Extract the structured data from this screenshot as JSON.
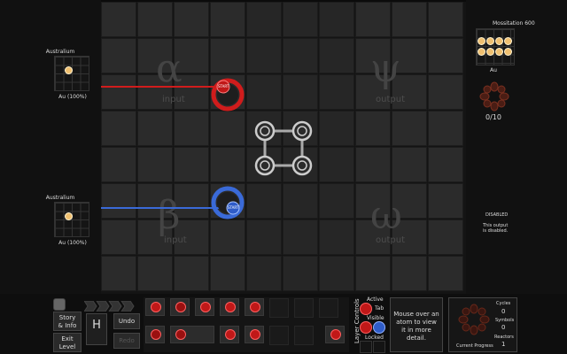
{
  "left_panel": {
    "element_top": {
      "name": "Australium",
      "symbol": "Au (100%)"
    },
    "element_bottom": {
      "name": "Australium",
      "symbol": "Au (100%)"
    }
  },
  "zones": {
    "alpha": {
      "letter": "α",
      "label": "input"
    },
    "beta": {
      "letter": "β",
      "label": "input"
    },
    "psi": {
      "letter": "ψ",
      "label": "output"
    },
    "omega": {
      "letter": "ω",
      "label": "output"
    }
  },
  "waldos": {
    "red_label": "START",
    "blue_label": "START"
  },
  "right_panel": {
    "output_name": "Mossitation 600",
    "output_symbol": "Au",
    "progress": "0/10",
    "disabled_title": "DISABLED",
    "disabled_text_1": "This output",
    "disabled_text_2": "is disabled."
  },
  "bottom": {
    "story_label_1": "Story",
    "story_label_2": "& Info",
    "exit_label_1": "Exit",
    "exit_label_2": "Level",
    "undo_label": "Undo",
    "redo_label": "Redo",
    "hydrogen_symbol": "H",
    "layer_controls_label": "Layer Controls",
    "active_label": "Active",
    "tab_key": "Tab",
    "visible_label": "Visible",
    "locked_label": "Locked",
    "info_text": "Mouse over an atom to view it in more detail.",
    "current_progress_label": "Current Progress",
    "cycles_label": "Cycles",
    "cycles_value": "0",
    "symbols_label": "Symbols",
    "symbols_value": "0",
    "reactors_label": "Reactors",
    "reactors_value": "1"
  },
  "colors": {
    "red": "#d01c1c",
    "blue": "#3a6ad8",
    "atom": "#f0c070"
  }
}
